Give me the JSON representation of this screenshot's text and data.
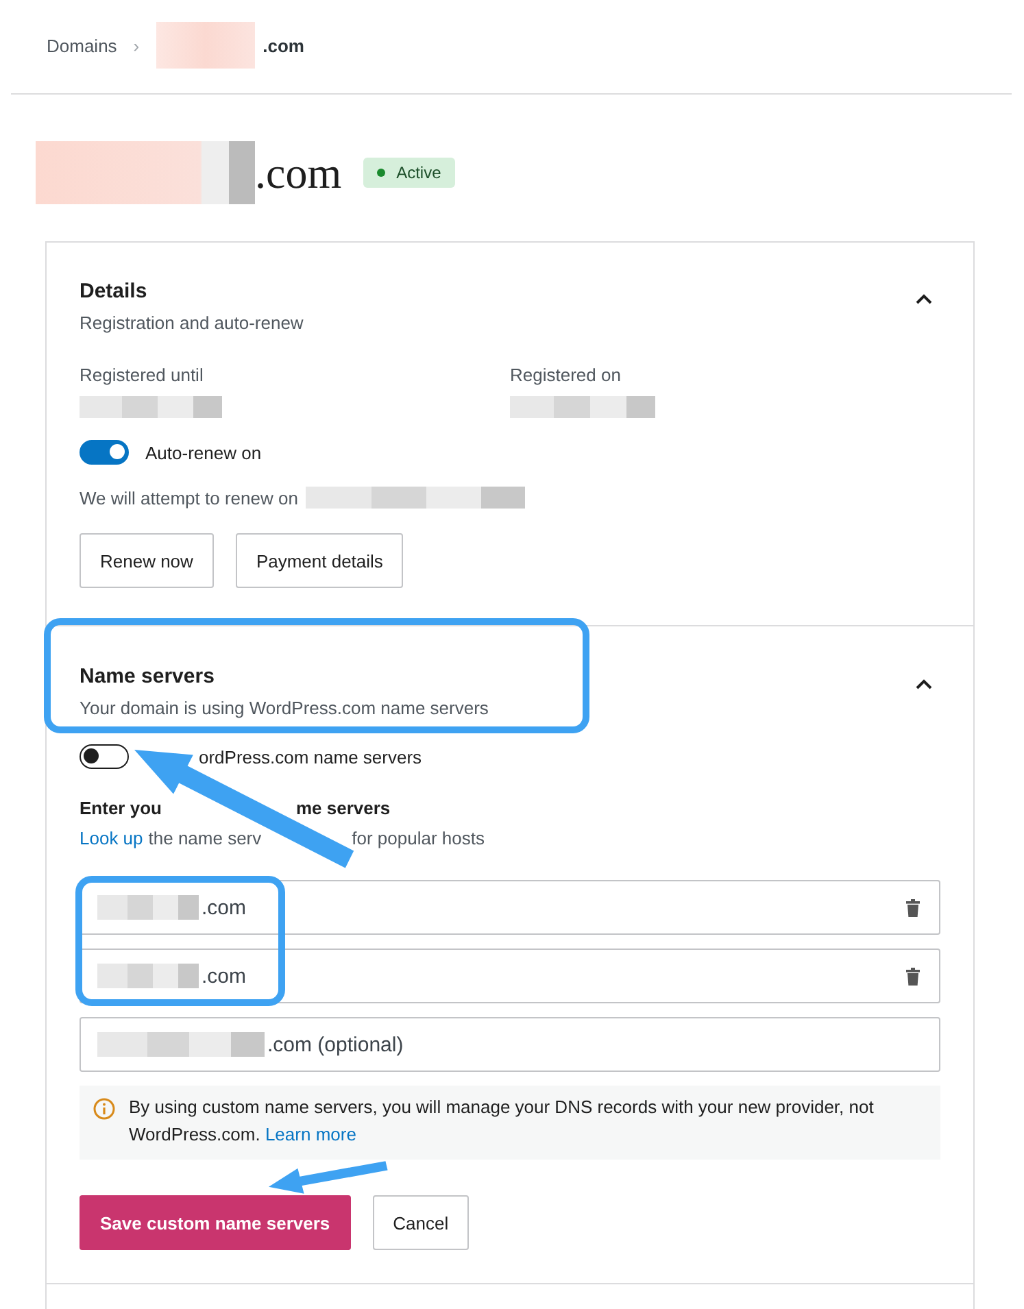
{
  "breadcrumb": {
    "root": "Domains",
    "separator": "›",
    "current_suffix": ".com"
  },
  "domain": {
    "suffix": ".com",
    "status": "Active"
  },
  "details": {
    "title": "Details",
    "subtitle": "Registration and auto-renew",
    "expanded": true,
    "registered_until_label": "Registered until",
    "registered_on_label": "Registered on",
    "auto_renew": {
      "label": "Auto-renew on",
      "on": true
    },
    "renew_text": "We will attempt to renew on",
    "buttons": [
      "Renew now",
      "Payment details"
    ]
  },
  "name_servers": {
    "title": "Name servers",
    "subtitle": "Your domain is using WordPress.com name servers",
    "expanded": true,
    "default_toggle": {
      "label": "ordPress.com name servers",
      "on": false
    },
    "custom_heading": [
      "Enter you",
      "me servers"
    ],
    "lookup_link": "Look up",
    "lookup_text": [
      "the name serv",
      "for popular hosts"
    ],
    "fields": [
      {
        "value": ".com",
        "removable": true
      },
      {
        "value": ".com",
        "removable": true
      },
      {
        "value": ".com (optional)",
        "removable": false
      }
    ],
    "notice": {
      "text": "By using custom name servers, you will manage your DNS records with your new provider, not WordPress.com.",
      "link": "Learn more"
    },
    "save_button": "Save custom name servers",
    "cancel_button": "Cancel"
  }
}
